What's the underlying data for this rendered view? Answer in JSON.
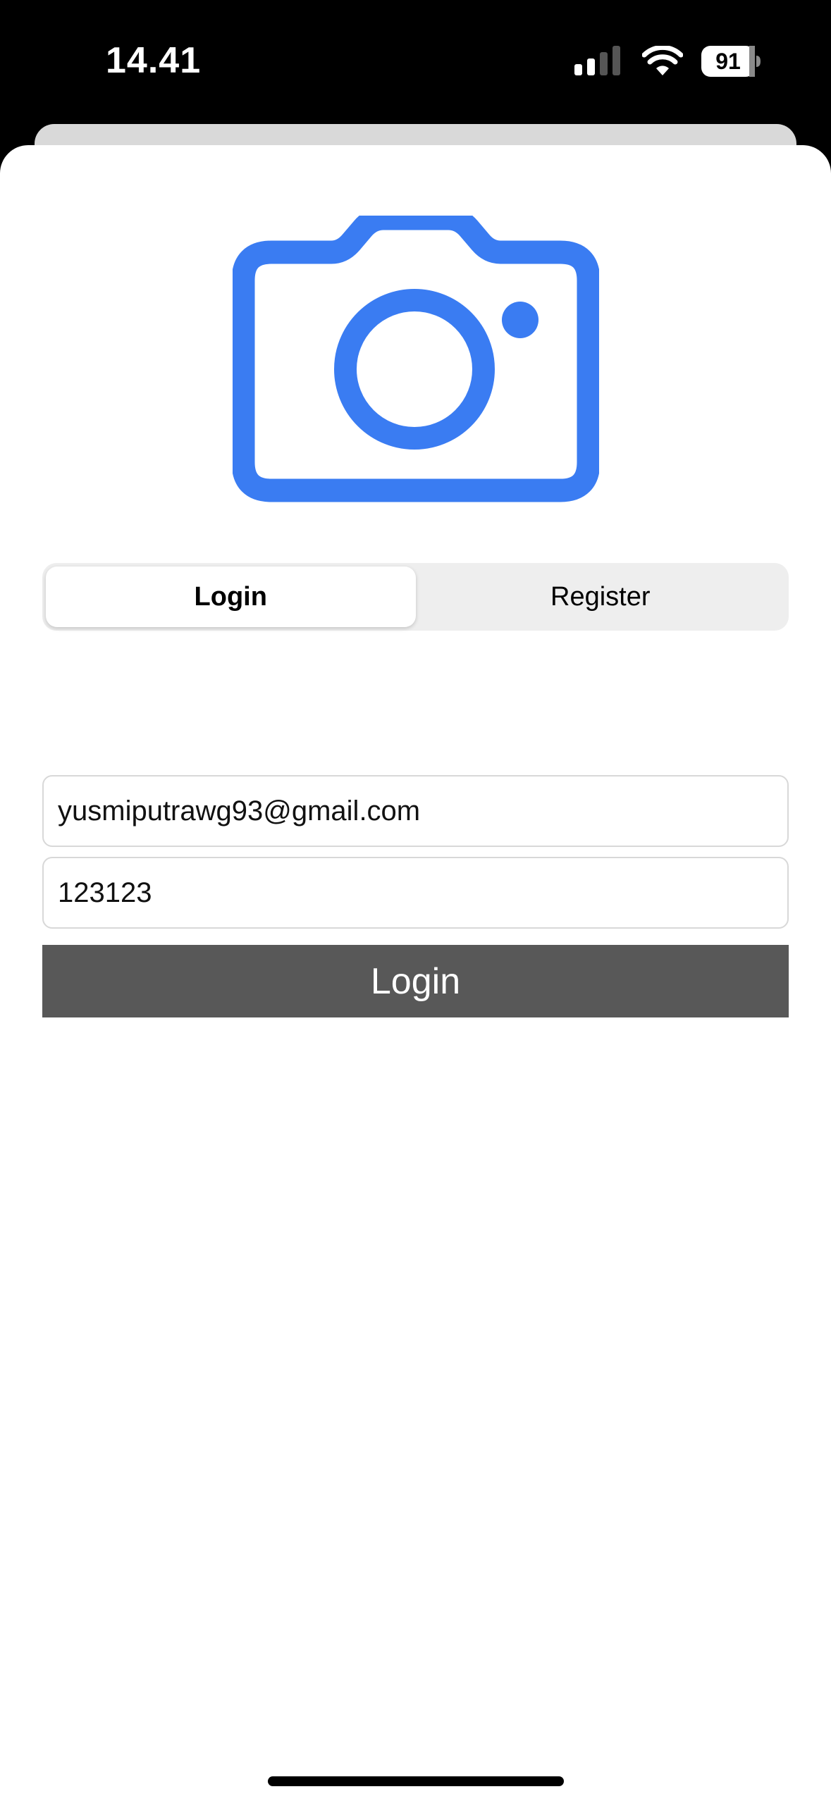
{
  "status_bar": {
    "time": "14.41",
    "battery_level": "91",
    "icons": [
      "signal-icon",
      "wifi-icon",
      "battery-icon"
    ]
  },
  "logo": {
    "icon": "camera-icon",
    "color": "#3a7cf2"
  },
  "auth_tabs": {
    "items": [
      {
        "label": "Login",
        "selected": true
      },
      {
        "label": "Register",
        "selected": false
      }
    ]
  },
  "form": {
    "email_value": "yusmiputrawg93@gmail.com",
    "password_value": "123123",
    "submit_label": "Login",
    "submit_color": "#585858"
  }
}
